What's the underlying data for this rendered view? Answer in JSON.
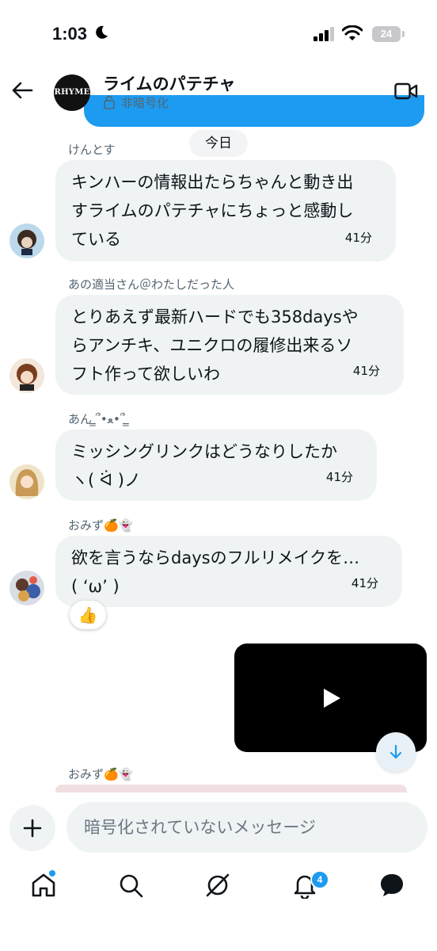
{
  "status_bar": {
    "time": "1:03",
    "battery": "24"
  },
  "header": {
    "group_name": "ライムのパテチャ",
    "group_avatar_text": "RHYME",
    "encryption_status": "非暗号化"
  },
  "date_divider": "今日",
  "messages": [
    {
      "sender": "けんとす",
      "lines": [
        "キンハーの情報出たらちゃんと動き出",
        "すライムのパテチャにちょっと感動し",
        "ている"
      ],
      "time": "41分"
    },
    {
      "sender": "あの適当さん＠わたしだった人",
      "lines": [
        "とりあえず最新ハードでも358daysや",
        "らアンチキ、ユニクロの履修出来るソ",
        "フト作って欲しいわ"
      ],
      "time": "41分"
    },
    {
      "sender": "あん ̳՞•ﻌ•՞ ̳",
      "lines": [
        "ミッシングリンクはどうなりしたか",
        "ヽ( ᐛ )ノ"
      ],
      "time": "41分"
    },
    {
      "sender": "おみず🍊👻",
      "lines": [
        "欲を言うならdaysのフルリメイクを…",
        "( ‘ω’ )"
      ],
      "time": "41分",
      "reaction": "👍"
    }
  ],
  "next_sender": "おみず🍊👻",
  "composer": {
    "placeholder": "暗号化されていないメッセージ"
  },
  "nav": {
    "notifications_badge": "4"
  },
  "colors": {
    "accent": "#1d9bf0",
    "bubble": "#eff3f4",
    "secondary_text": "#536471"
  },
  "icons": [
    "back-arrow-icon",
    "lock-icon",
    "video-call-icon",
    "play-icon",
    "arrow-down-icon",
    "plus-icon",
    "home-icon",
    "search-icon",
    "grok-icon",
    "bell-icon",
    "messages-icon"
  ]
}
